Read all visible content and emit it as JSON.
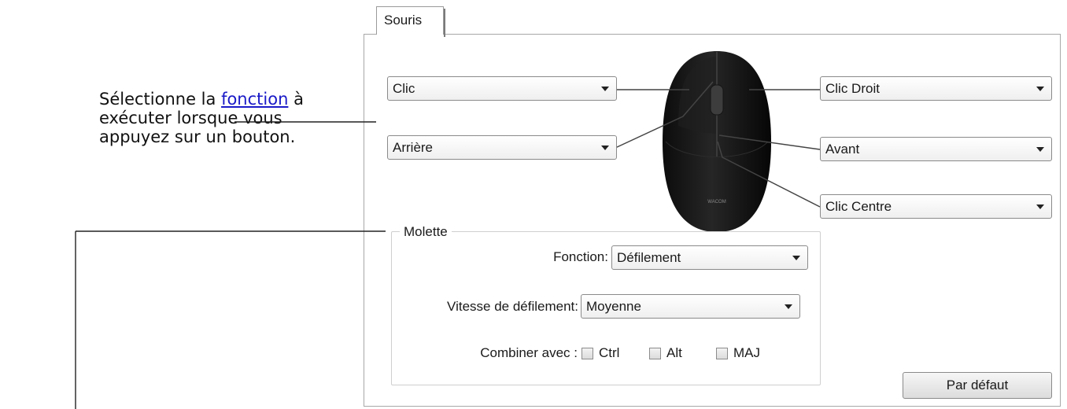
{
  "callout": {
    "text_before": "Sélectionne la ",
    "link": "fonction",
    "text_after_line1": " à",
    "line2": "exécuter lorsque vous",
    "line3": "appuyez sur un bouton."
  },
  "tab": {
    "label": "Souris"
  },
  "buttons": {
    "left_top": "Clic",
    "left_bottom": "Arrière",
    "right_top": "Clic Droit",
    "right_middle": "Avant",
    "right_bottom": "Clic Centre"
  },
  "mouse": {
    "brand": "WACOM"
  },
  "wheel": {
    "group_label": "Molette",
    "function_label": "Fonction:",
    "function_value": "Défilement",
    "speed_label": "Vitesse de défilement:",
    "speed_value": "Moyenne",
    "combine_label": "Combiner avec :",
    "modifiers": [
      "Ctrl",
      "Alt",
      "MAJ"
    ]
  },
  "default_button": "Par défaut"
}
